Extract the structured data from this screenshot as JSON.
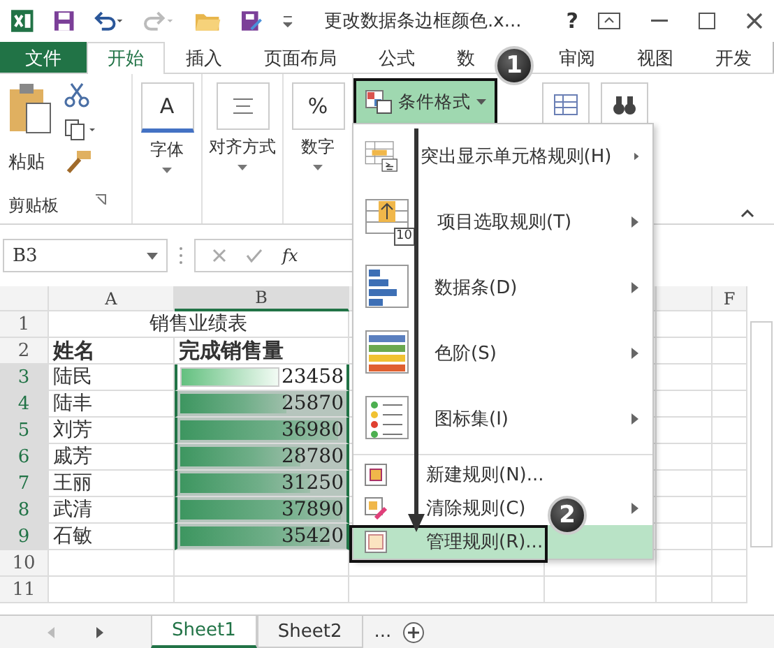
{
  "title_bar": {
    "title": "更改数据条边框颜色.x...",
    "help": "?"
  },
  "ribbon_tabs": [
    {
      "label": "文件",
      "kind": "file",
      "selected": false
    },
    {
      "label": "开始",
      "kind": "tab",
      "selected": true
    },
    {
      "label": "插入",
      "kind": "tab",
      "selected": false
    },
    {
      "label": "页面布局",
      "kind": "tab",
      "selected": false
    },
    {
      "label": "公式",
      "kind": "tab",
      "selected": false
    },
    {
      "label": "数",
      "kind": "covered",
      "selected": false
    },
    {
      "label": "审阅",
      "kind": "tab",
      "selected": false
    },
    {
      "label": "视图",
      "kind": "tab",
      "selected": false
    },
    {
      "label": "开发",
      "kind": "tab",
      "selected": false
    }
  ],
  "clipboard": {
    "paste": "粘贴",
    "label": "剪贴板"
  },
  "ribbon_buttons": [
    {
      "label": "字体",
      "icon_text": "A"
    },
    {
      "label": "对齐方式"
    },
    {
      "label": "数字",
      "icon_text": "%"
    }
  ],
  "conditional_format": {
    "label": "条件格式",
    "selected": true
  },
  "formula_bar": {
    "name_box": "B3",
    "fx": "fx"
  },
  "sheet": {
    "columns": [
      "A",
      "B",
      "F"
    ],
    "title": "销售业绩表",
    "header": [
      "姓名",
      "完成销售量"
    ],
    "rows": [
      {
        "name": "陆民",
        "value": "23458",
        "level": 0.62,
        "active": true
      },
      {
        "name": "陆丰",
        "value": "25870",
        "level": 0.68,
        "active": false
      },
      {
        "name": "刘芳",
        "value": "36980",
        "level": 0.98,
        "active": false
      },
      {
        "name": "戚芳",
        "value": "28780",
        "level": 0.76,
        "active": false
      },
      {
        "name": "王丽",
        "value": "31250",
        "level": 0.82,
        "active": false
      },
      {
        "name": "武清",
        "value": "37890",
        "level": 1.0,
        "active": false
      },
      {
        "name": "石敏",
        "value": "35420",
        "level": 0.93,
        "active": false
      }
    ],
    "row_numbers": [
      "1",
      "2",
      "3",
      "4",
      "5",
      "6",
      "7",
      "8",
      "9",
      "10",
      "11"
    ]
  },
  "menu": {
    "items": [
      {
        "label": "突出显示单元格规则(H)",
        "kind": "highlight",
        "submenu": true,
        "selected": false
      },
      {
        "label": "项目选取规则(T)",
        "kind": "top",
        "submenu": true,
        "selected": false
      },
      {
        "label": "数据条(D)",
        "kind": "databar",
        "submenu": true,
        "selected": false
      },
      {
        "label": "色阶(S)",
        "kind": "scale",
        "submenu": true,
        "selected": false
      },
      {
        "label": "图标集(I)",
        "kind": "iconset",
        "submenu": true,
        "selected": false
      },
      {
        "label": "新建规则(N)...",
        "kind": "new",
        "submenu": false,
        "selected": false
      },
      {
        "label": "清除规则(C)",
        "kind": "clear",
        "submenu": true,
        "selected": false
      },
      {
        "label": "管理规则(R)...",
        "kind": "manage",
        "submenu": false,
        "selected": true
      }
    ],
    "top_icon_text": "10"
  },
  "callouts": [
    "1",
    "2"
  ],
  "sheet_tabs": [
    {
      "label": "Sheet1",
      "selected": true
    },
    {
      "label": "Sheet2",
      "selected": false
    }
  ],
  "sheet_tabs_more": "..."
}
